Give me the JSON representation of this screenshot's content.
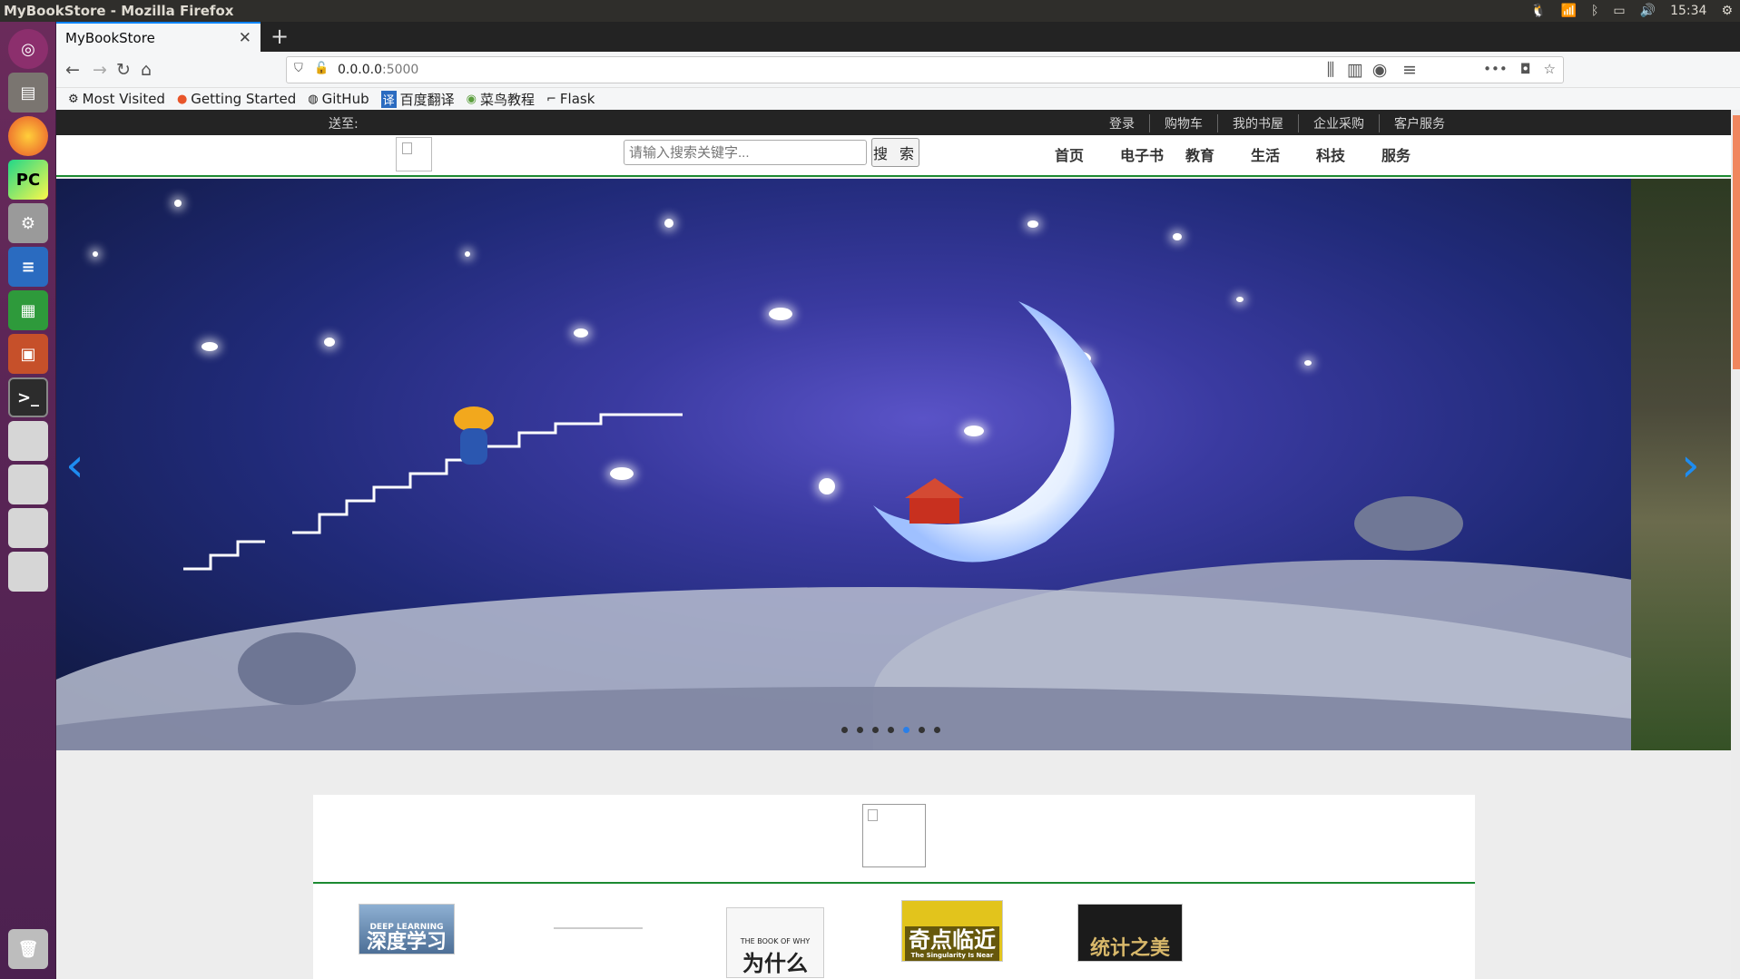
{
  "window": {
    "title": "MyBookStore - Mozilla Firefox",
    "time": "15:34"
  },
  "browser": {
    "tab_title": "MyBookStore",
    "url_host": "0.0.0.0",
    "url_port": ":5000",
    "bookmarks": [
      {
        "label": "Most Visited",
        "icon": "gear-icon"
      },
      {
        "label": "Getting Started",
        "icon": "firefox-icon"
      },
      {
        "label": "GitHub",
        "icon": "github-icon"
      },
      {
        "label": "百度翻译",
        "icon": "translate-icon"
      },
      {
        "label": "菜鸟教程",
        "icon": "runoob-icon"
      },
      {
        "label": "Flask",
        "icon": "flask-icon"
      }
    ]
  },
  "site": {
    "deliver_label": "送至:",
    "top_links": [
      "登录",
      "购物车",
      "我的书屋",
      "企业采购",
      "客户服务"
    ],
    "search_placeholder": "请输入搜索关键字...",
    "search_button": "搜 索",
    "nav": [
      "首页",
      "电子书",
      "教育",
      "生活",
      "科技",
      "服务"
    ],
    "carousel": {
      "dots": 7,
      "active_dot": 5
    }
  },
  "books": [
    {
      "title": "深度学习",
      "subtitle": "DEEP LEARNING",
      "color": "#6c8fb5"
    },
    {
      "title": "",
      "subtitle": "",
      "color": "#f2f2f2"
    },
    {
      "title": "为什么",
      "subtitle": "THE BOOK OF WHY",
      "color": "#f5f5f5"
    },
    {
      "title": "奇点临近",
      "subtitle": "The Singularity Is Near",
      "color": "#e0c31b"
    },
    {
      "title": "统计之美",
      "subtitle": "",
      "color": "#1b1b1b"
    }
  ],
  "colors": {
    "accent_green": "#1c8a32",
    "link_blue": "#1e8cf0"
  }
}
